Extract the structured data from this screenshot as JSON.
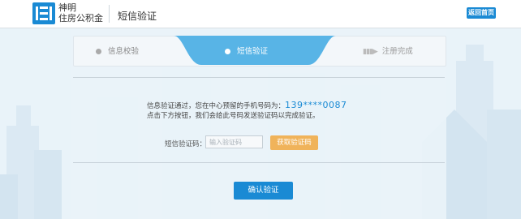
{
  "header": {
    "brand_line1": "神明",
    "brand_line2": "住房公积金",
    "page_title": "短信验证",
    "home_button": "返回首页"
  },
  "steps": [
    {
      "label": "信息校验",
      "state": "done"
    },
    {
      "label": "短信验证",
      "state": "active"
    },
    {
      "label": "注册完成",
      "state": "pending"
    }
  ],
  "message": {
    "line1_prefix": "信息验证通过，您在中心预留的手机号码为：",
    "phone": "139****0087",
    "line2": "点击下方按钮，我们会给此号码发送验证码以完成验证。"
  },
  "sms_code": {
    "label": "短信验证码：",
    "placeholder": "输入验证码",
    "get_code_button": "获取验证码"
  },
  "confirm_button": "确认验证",
  "colors": {
    "primary": "#1a8ad4",
    "active_step": "#58b4e6",
    "secondary_button": "#f0b35a",
    "background": "#e9f3f9"
  }
}
